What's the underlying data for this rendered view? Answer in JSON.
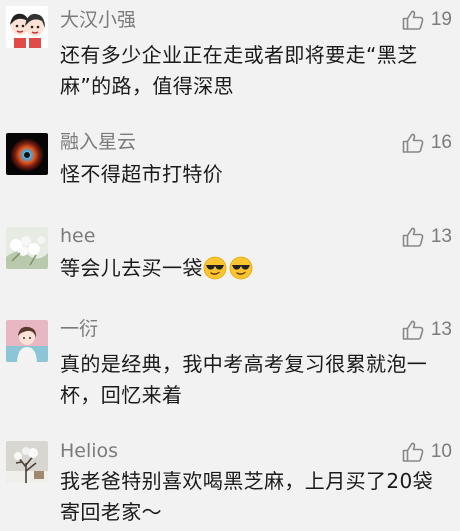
{
  "comments": [
    {
      "username": "大汉小强",
      "likes": "19",
      "content": "还有多少企业正在走或者即将要走“黑芝麻”的路，值得深思",
      "avatar": "couple-cartoon-avatar"
    },
    {
      "username": "融入星云",
      "likes": "16",
      "content": "怪不得超市打特价",
      "avatar": "nebula-eye-avatar"
    },
    {
      "username": "hee",
      "likes": "13",
      "content": "等会儿去买一袋",
      "emojis": [
        "sunglasses-emoji",
        "sunglasses-emoji"
      ],
      "avatar": "white-flowers-avatar"
    },
    {
      "username": "一衍",
      "likes": "13",
      "content": "真的是经典，我中考高考复习很累就泡一杯，回忆来着",
      "avatar": "illustrated-girl-avatar"
    },
    {
      "username": "Helios",
      "likes": "10",
      "content": "我老爸特别喜欢喝黑芝麻，上月买了20袋寄回老家～",
      "avatar": "winter-tree-avatar"
    }
  ],
  "colors": {
    "background": "#f2f2f2",
    "username": "#7b7b7b",
    "content": "#1a1a1a",
    "like_icon": "#888888"
  }
}
